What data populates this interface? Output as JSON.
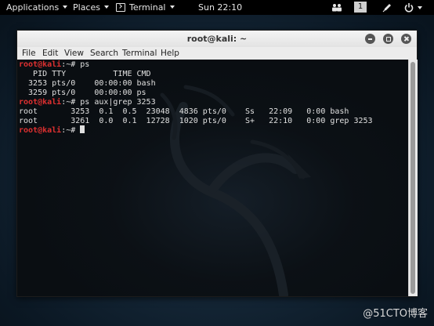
{
  "topbar": {
    "applications": "Applications",
    "places": "Places",
    "terminal": "Terminal",
    "clock": "Sun 22:10",
    "workspace": "1",
    "icons": [
      "people-icon",
      "workspace-indicator",
      "pen-icon",
      "power-icon"
    ]
  },
  "window": {
    "title": "root@kali: ~",
    "menu": [
      "File",
      "Edit",
      "View",
      "Search",
      "Terminal",
      "Help"
    ]
  },
  "terminal": {
    "lines": [
      {
        "prompt": "root@kali",
        "text": ":~# ps"
      },
      {
        "prompt": "",
        "text": "   PID TTY          TIME CMD"
      },
      {
        "prompt": "",
        "text": "  3253 pts/0    00:00:00 bash"
      },
      {
        "prompt": "",
        "text": "  3259 pts/0    00:00:00 ps"
      },
      {
        "prompt": "root@kali",
        "text": ":~# ps aux|grep 3253"
      },
      {
        "prompt": "",
        "text": "root       3253  0.1  0.5  23048  4836 pts/0    Ss   22:09   0:00 bash"
      },
      {
        "prompt": "",
        "text": "root       3261  0.0  0.1  12728  1020 pts/0    S+   22:10   0:00 grep 3253"
      },
      {
        "prompt": "root@kali",
        "text": ":~# "
      }
    ]
  },
  "watermark": "@51CTO博客",
  "colors": {
    "prompt": "#e03030",
    "terminal_text": "#e0e0e0",
    "terminal_bg": "#0a0e12",
    "desktop_bg": "#142636"
  }
}
